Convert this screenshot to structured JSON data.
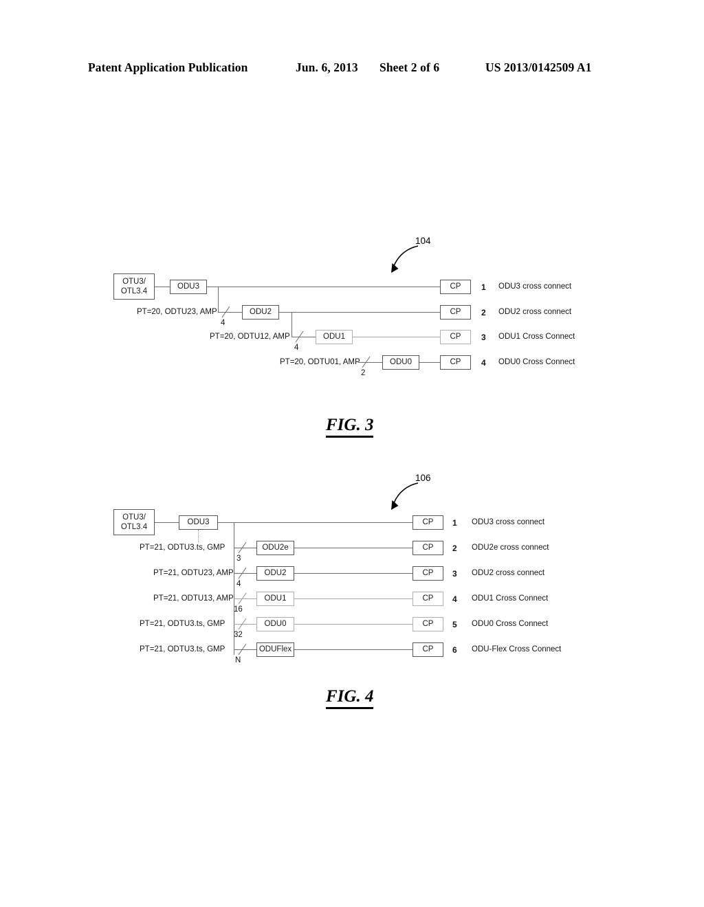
{
  "header": {
    "publication": "Patent Application Publication",
    "date": "Jun. 6, 2013",
    "sheet": "Sheet 2 of 6",
    "patent_number": "US 2013/0142509 A1"
  },
  "figures": [
    {
      "caption": "FIG. 3",
      "reference_numeral": "104",
      "source_box": "OTU3/\nOTL3.4",
      "source_box_line1": "OTU3/",
      "source_box_line2": "OTL3.4",
      "root_node": "ODU3",
      "mapping_labels": [
        "PT=20, ODTU23, AMP",
        "PT=20, ODTU12, AMP",
        "PT=20, ODTU01, AMP"
      ],
      "multiplicities": [
        "4",
        "4",
        "2"
      ],
      "nodes": [
        "ODU3",
        "ODU2",
        "ODU1",
        "ODU0"
      ],
      "endpoint_label": "CP",
      "rows": [
        {
          "index": "1",
          "node": "ODU3",
          "cp": "CP",
          "description": "ODU3 cross connect"
        },
        {
          "index": "2",
          "node": "ODU2",
          "cp": "CP",
          "description": "ODU2 cross connect"
        },
        {
          "index": "3",
          "node": "ODU1",
          "cp": "CP",
          "description": "ODU1 Cross Connect"
        },
        {
          "index": "4",
          "node": "ODU0",
          "cp": "CP",
          "description": "ODU0 Cross Connect"
        }
      ]
    },
    {
      "caption": "FIG. 4",
      "reference_numeral": "106",
      "source_box_line1": "OTU3/",
      "source_box_line2": "OTL3.4",
      "root_node": "ODU3",
      "mapping_labels": [
        "PT=21, ODTU3.ts, GMP",
        "PT=21, ODTU23, AMP",
        "PT=21, ODTU13, AMP",
        "PT=21, ODTU3.ts, GMP",
        "PT=21, ODTU3.ts, GMP"
      ],
      "multiplicities": [
        "3",
        "4",
        "16",
        "32",
        "N"
      ],
      "endpoint_label": "CP",
      "rows": [
        {
          "index": "1",
          "node": "ODU3",
          "cp": "CP",
          "description": "ODU3 cross connect"
        },
        {
          "index": "2",
          "node": "ODU2e",
          "cp": "CP",
          "description": "ODU2e cross connect"
        },
        {
          "index": "3",
          "node": "ODU2",
          "cp": "CP",
          "description": "ODU2 cross connect"
        },
        {
          "index": "4",
          "node": "ODU1",
          "cp": "CP",
          "description": "ODU1 Cross Connect"
        },
        {
          "index": "5",
          "node": "ODU0",
          "cp": "CP",
          "description": "ODU0 Cross Connect"
        },
        {
          "index": "6",
          "node": "ODUFlex",
          "cp": "CP",
          "description": "ODU-Flex Cross Connect"
        }
      ]
    }
  ],
  "colors": {
    "ink": "#000000",
    "line": "#6e6e6e",
    "line_faint": "#a7a7a7",
    "box_border": "#7d7d7d",
    "paper": "#ffffff"
  }
}
